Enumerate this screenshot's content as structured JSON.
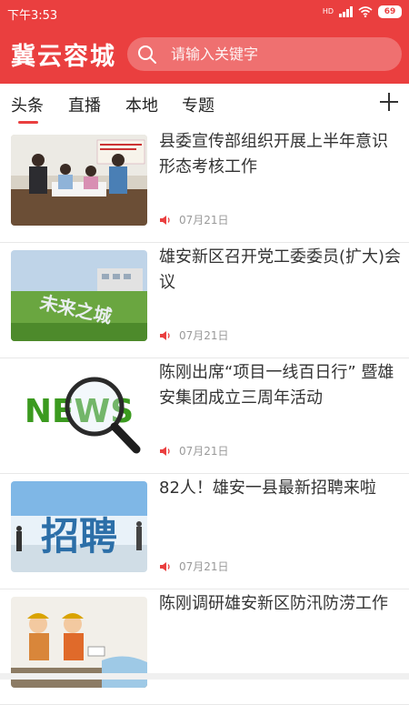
{
  "status_bar": {
    "time": "下午3:53",
    "network": "HD",
    "battery": "69"
  },
  "app_bar": {
    "title": "冀云容城",
    "search_placeholder": "请输入关键字"
  },
  "tabs": [
    {
      "label": "头条",
      "active": true
    },
    {
      "label": "直播"
    },
    {
      "label": "本地"
    },
    {
      "label": "专题"
    }
  ],
  "colors": {
    "accent": "#ea3f3f"
  },
  "news": [
    {
      "title": "县委宣传部组织开展上半年意识形态考核工作",
      "date": "07月21日",
      "thumb": "meeting-photo"
    },
    {
      "title": "雄安新区召开党工委委员(扩大)会议",
      "date": "07月21日",
      "thumb": "city-sign-photo"
    },
    {
      "title": "陈刚出席“项目一线百日行” 暨雄安集团成立三周年活动",
      "date": "07月21日",
      "thumb": "news-magnifier-graphic"
    },
    {
      "title": "82人！雄安一县最新招聘来啦",
      "date": "07月21日",
      "thumb": "recruitment-graphic"
    },
    {
      "title": "陈刚调研雄安新区防汛防涝工作",
      "date": "",
      "thumb": "flood-control-cartoon"
    }
  ],
  "thumb_text": {
    "news_graphic": "NEWS",
    "recruit_graphic": "招聘",
    "city_sign": "未来之城"
  }
}
